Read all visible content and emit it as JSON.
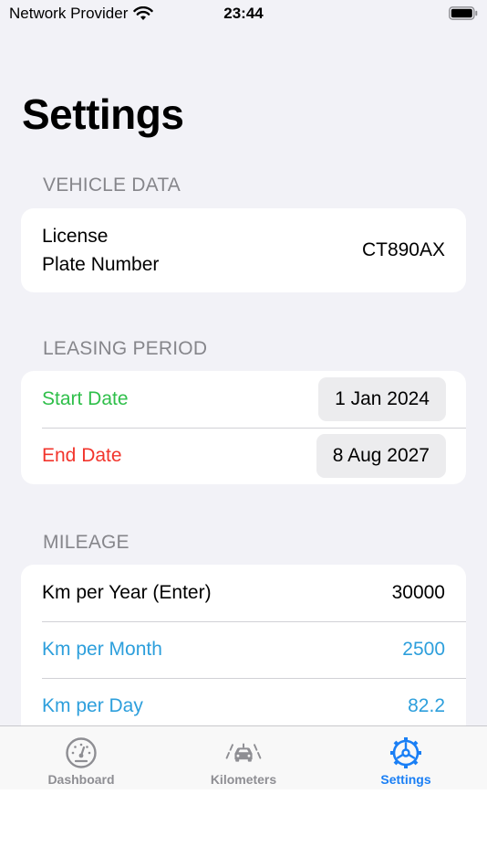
{
  "status_bar": {
    "carrier": "Network Provider",
    "time": "23:44"
  },
  "page": {
    "title": "Settings"
  },
  "vehicle": {
    "header": "Vehicle Data",
    "license_label_line1": "License",
    "license_label_line2": "Plate Number",
    "license_value": "CT890AX"
  },
  "leasing": {
    "header": "Leasing Period",
    "start_label": "Start Date",
    "start_value": "1 Jan 2024",
    "end_label": "End Date",
    "end_value": "8 Aug 2027"
  },
  "mileage": {
    "header": "Mileage",
    "per_year_label": "Km per Year (Enter)",
    "per_year_value": "30000",
    "per_month_label": "Km per Month",
    "per_month_value": "2500",
    "per_day_label": "Km per Day",
    "per_day_value": "82.2"
  },
  "tabs": [
    {
      "label": "Dashboard",
      "icon": "gauge-icon"
    },
    {
      "label": "Kilometers",
      "icon": "road-car-icon"
    },
    {
      "label": "Settings",
      "icon": "gear-icon"
    }
  ],
  "colors": {
    "accent": "#1a7ff5",
    "green": "#2fbf4a",
    "red": "#f2352c",
    "blue": "#2d9fdc"
  }
}
